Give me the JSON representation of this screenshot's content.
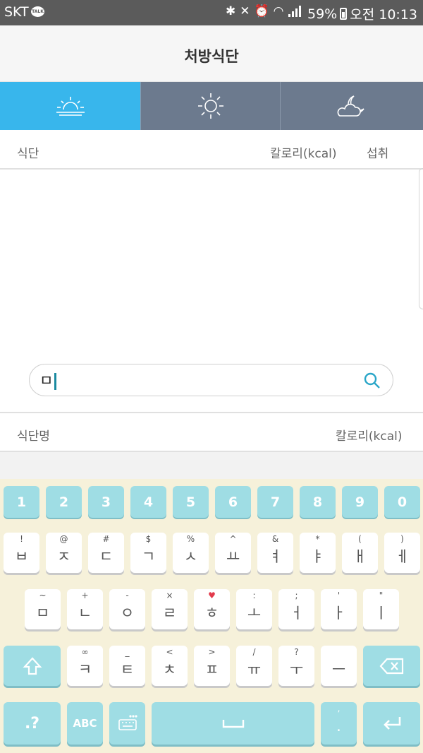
{
  "status": {
    "carrier": "SKT",
    "talk_badge": "TALK",
    "battery": "59%",
    "time": "오전 10:13",
    "icons": [
      "bluetooth-icon",
      "mute-icon",
      "alarm-icon",
      "wifi-icon",
      "signal-icon",
      "battery-icon"
    ]
  },
  "header": {
    "title": "처방식단"
  },
  "tabs": [
    {
      "icon": "sunrise-icon",
      "active": true
    },
    {
      "icon": "sun-icon",
      "active": false
    },
    {
      "icon": "moon-cloud-icon",
      "active": false
    }
  ],
  "table_header": {
    "food": "식단",
    "calories": "칼로리(kcal)",
    "intake": "섭취"
  },
  "search": {
    "value": "ㅁ",
    "icon": "search-icon"
  },
  "result_header": {
    "name": "식단명",
    "calories": "칼로리(kcal)"
  },
  "keyboard": {
    "numbers": [
      "1",
      "2",
      "3",
      "4",
      "5",
      "6",
      "7",
      "8",
      "9",
      "0"
    ],
    "row1": [
      {
        "sym": "!",
        "ch": "ㅂ"
      },
      {
        "sym": "@",
        "ch": "ㅈ"
      },
      {
        "sym": "#",
        "ch": "ㄷ"
      },
      {
        "sym": "$",
        "ch": "ㄱ"
      },
      {
        "sym": "%",
        "ch": "ㅅ"
      },
      {
        "sym": "^",
        "ch": "ㅛ"
      },
      {
        "sym": "&",
        "ch": "ㅕ"
      },
      {
        "sym": "*",
        "ch": "ㅑ"
      },
      {
        "sym": "(",
        "ch": "ㅐ"
      },
      {
        "sym": ")",
        "ch": "ㅔ"
      }
    ],
    "row2": [
      {
        "sym": "~",
        "ch": "ㅁ"
      },
      {
        "sym": "+",
        "ch": "ㄴ"
      },
      {
        "sym": "-",
        "ch": "ㅇ"
      },
      {
        "sym": "×",
        "ch": "ㄹ"
      },
      {
        "sym": "♥",
        "ch": "ㅎ"
      },
      {
        "sym": ":",
        "ch": "ㅗ"
      },
      {
        "sym": ";",
        "ch": "ㅓ"
      },
      {
        "sym": "'",
        "ch": "ㅏ"
      },
      {
        "sym": "\"",
        "ch": "ㅣ"
      }
    ],
    "row3": [
      {
        "sym": "∞",
        "ch": "ㅋ"
      },
      {
        "sym": "_",
        "ch": "ㅌ"
      },
      {
        "sym": "<",
        "ch": "ㅊ"
      },
      {
        "sym": ">",
        "ch": "ㅍ"
      },
      {
        "sym": "/",
        "ch": "ㅠ"
      },
      {
        "sym": "?",
        "ch": "ㅜ"
      },
      {
        "sym": "",
        "ch": "ㅡ"
      }
    ],
    "bottom": {
      "sym_label": ".?",
      "abc_label": "ABC",
      "period_sym": ",",
      "period_label": "."
    }
  }
}
